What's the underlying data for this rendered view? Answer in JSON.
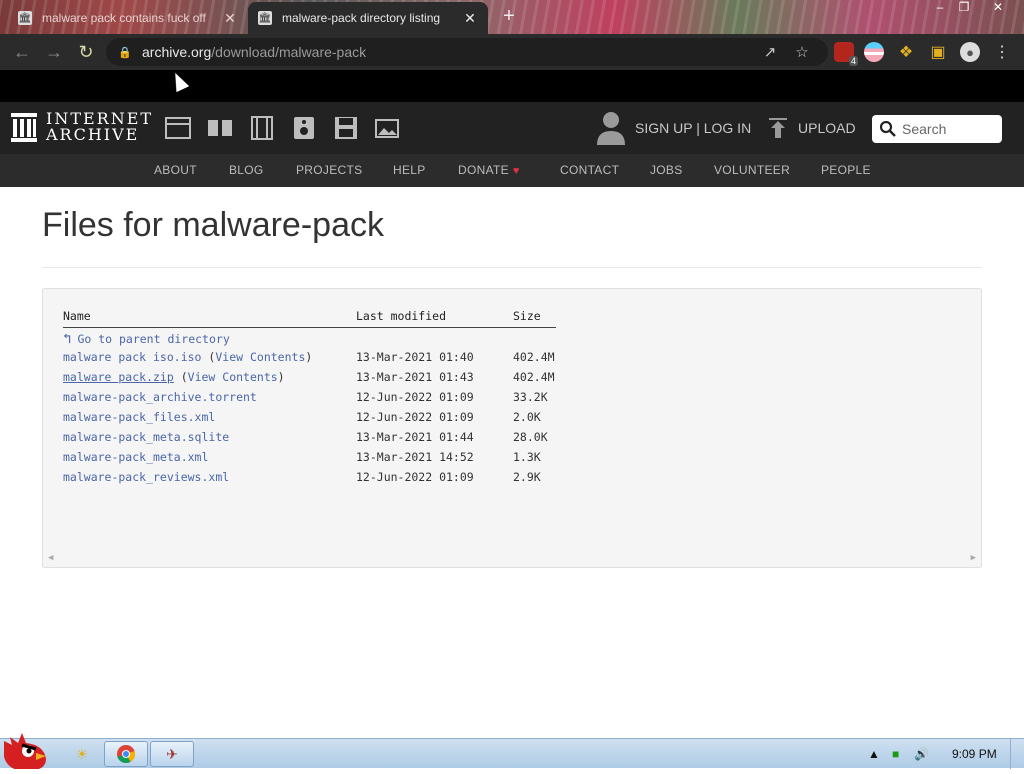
{
  "browser": {
    "tabs": [
      {
        "title": "malware pack contains fuck off",
        "active": false,
        "close": "✕"
      },
      {
        "title": "malware-pack directory listing",
        "active": true,
        "close": "✕"
      }
    ],
    "new_tab": "+",
    "url_host": "archive.org",
    "url_path": "/download/malware-pack",
    "extension_badge": "4"
  },
  "ia_header": {
    "logo_line1": "INTERNET",
    "logo_line2": "ARCHIVE",
    "signup_login": "SIGN UP | LOG IN",
    "upload": "UPLOAD",
    "search_placeholder": "Search",
    "nav": [
      "ABOUT",
      "BLOG",
      "PROJECTS",
      "HELP",
      "DONATE",
      "CONTACT",
      "JOBS",
      "VOLUNTEER",
      "PEOPLE"
    ]
  },
  "page": {
    "title": "Files for malware-pack"
  },
  "listing": {
    "headers": {
      "name": "Name",
      "modified": "Last modified",
      "size": "Size"
    },
    "parent": "Go to parent directory",
    "view_contents": "View Contents",
    "rows": [
      {
        "name": "malware pack iso.iso",
        "modified": "13-Mar-2021 01:40",
        "size": "402.4M",
        "has_contents": true
      },
      {
        "name": "malware pack.zip",
        "modified": "13-Mar-2021 01:43",
        "size": "402.4M",
        "has_contents": true
      },
      {
        "name": "malware-pack_archive.torrent",
        "modified": "12-Jun-2022 01:09",
        "size": "33.2K",
        "has_contents": false
      },
      {
        "name": "malware-pack_files.xml",
        "modified": "12-Jun-2022 01:09",
        "size": "2.0K",
        "has_contents": false
      },
      {
        "name": "malware-pack_meta.sqlite",
        "modified": "13-Mar-2021 01:44",
        "size": "28.0K",
        "has_contents": false
      },
      {
        "name": "malware-pack_meta.xml",
        "modified": "13-Mar-2021 14:52",
        "size": "1.3K",
        "has_contents": false
      },
      {
        "name": "malware-pack_reviews.xml",
        "modified": "12-Jun-2022 01:09",
        "size": "2.9K",
        "has_contents": false
      }
    ]
  },
  "taskbar": {
    "clock": "9:09 PM"
  },
  "colors": {
    "link": "#4b66a8",
    "ia_header_bg": "#222222",
    "ia_nav_bg": "#2c2c2c",
    "donate_heart": "#e0304a"
  }
}
